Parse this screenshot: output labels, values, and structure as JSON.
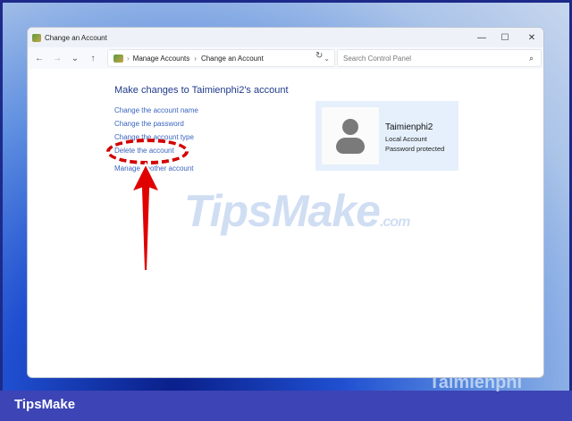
{
  "window": {
    "title": "Change an Account",
    "minimize": "—",
    "maximize": "☐",
    "close": "✕"
  },
  "nav": {
    "back": "←",
    "forward": "→",
    "recent": "⌄",
    "up": "↑",
    "breadcrumb": [
      "Manage Accounts",
      "Change an Account"
    ],
    "separator": "›",
    "dropdown": "⌄",
    "refresh": "↻",
    "search_placeholder": "Search Control Panel",
    "search_icon": "⌕"
  },
  "main": {
    "heading": "Make changes to Taimienphi2's account",
    "links": [
      "Change the account name",
      "Change the password",
      "Change the account type",
      "Delete the account",
      "Manage another account"
    ]
  },
  "account": {
    "name": "Taimienphi2",
    "type": "Local Account",
    "status": "Password protected"
  },
  "watermark": {
    "text": "TipsMake",
    "suffix": ".com"
  },
  "footer": {
    "brand": "TipsMake",
    "corner_logo": "Taimienphi"
  },
  "colors": {
    "link": "#3a64c0",
    "heading": "#1e3a8a",
    "highlight": "#d40000",
    "footer": "#3d44b5"
  }
}
